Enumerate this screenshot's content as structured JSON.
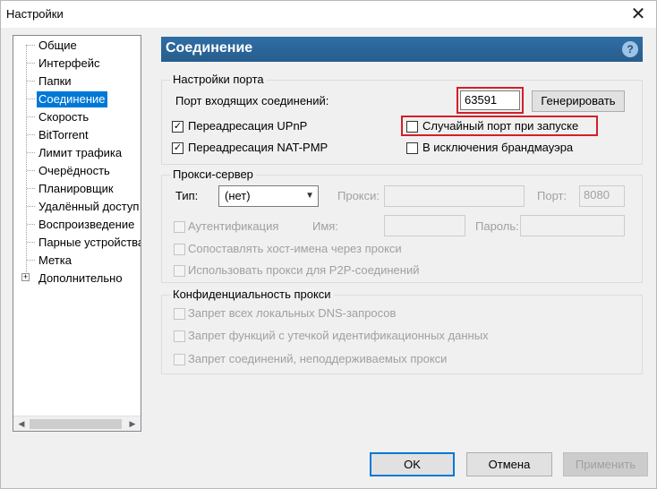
{
  "window": {
    "title": "Настройки",
    "close_glyph": "✕"
  },
  "sidebar": {
    "items": [
      {
        "label": "Общие"
      },
      {
        "label": "Интерфейс"
      },
      {
        "label": "Папки"
      },
      {
        "label": "Соединение",
        "selected": true
      },
      {
        "label": "Скорость"
      },
      {
        "label": "BitTorrent"
      },
      {
        "label": "Лимит трафика"
      },
      {
        "label": "Очерёдность"
      },
      {
        "label": "Планировщик"
      },
      {
        "label": "Удалённый доступ"
      },
      {
        "label": "Воспроизведение"
      },
      {
        "label": "Парные устройства"
      },
      {
        "label": "Метка"
      },
      {
        "label": "Дополнительно",
        "expandable": true
      }
    ]
  },
  "header": {
    "title": "Соединение",
    "help_glyph": "?"
  },
  "port": {
    "group_title": "Настройки порта",
    "incoming_label": "Порт входящих соединений:",
    "port_value": "63591",
    "generate_label": "Генерировать",
    "upnp_label": "Переадресация UPnP",
    "upnp_checked": true,
    "natpmp_label": "Переадресация NAT-PMP",
    "natpmp_checked": true,
    "random_label": "Случайный порт при запуске",
    "random_checked": false,
    "firewall_label": "В исключения брандмауэра",
    "firewall_checked": false
  },
  "proxy": {
    "group_title": "Прокси-сервер",
    "type_label": "Тип:",
    "type_value": "(нет)",
    "proxy_label": "Прокси:",
    "port_label": "Порт:",
    "port_value": "8080",
    "auth_label": "Аутентификация",
    "name_label": "Имя:",
    "password_label": "Пароль:",
    "resolve_label": "Сопоставлять хост-имена через прокси",
    "p2p_label": "Использовать прокси для P2P-соединений"
  },
  "privacy": {
    "group_title": "Конфиденциальность прокси",
    "dns_label": "Запрет всех локальных DNS-запросов",
    "leak_label": "Запрет функций с утечкой идентификационных данных",
    "unsupported_label": "Запрет соединений, неподдерживаемых прокси"
  },
  "footer": {
    "ok_label": "OK",
    "cancel_label": "Отмена",
    "apply_label": "Применить"
  },
  "colors": {
    "accent": "#0078d7",
    "header": "#2f6ea5",
    "highlight_box": "#d0202a"
  }
}
